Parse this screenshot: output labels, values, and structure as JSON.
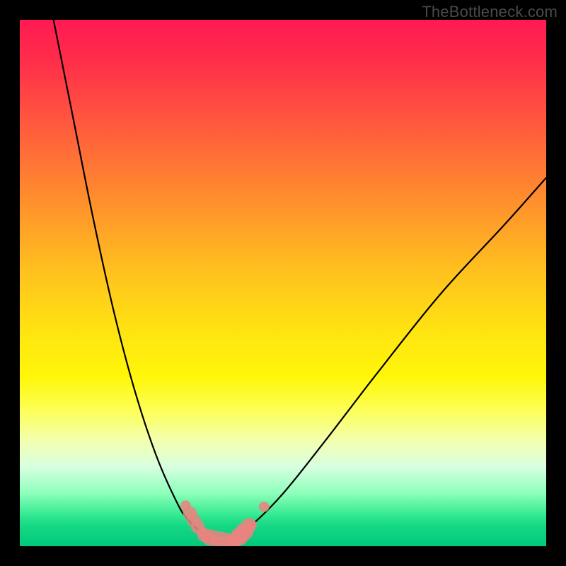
{
  "watermark": "TheBottleneck.com",
  "colors": {
    "background": "#000000",
    "curve": "#000000",
    "marker": "#e9847f",
    "gradient_top": "#ff1a52",
    "gradient_bottom": "#00c97c"
  },
  "chart_data": {
    "type": "line",
    "title": "",
    "xlabel": "",
    "ylabel": "",
    "xlim": [
      0,
      100
    ],
    "ylim": [
      0,
      100
    ],
    "grid": false,
    "series": [
      {
        "name": "left-curve",
        "x": [
          6,
          10,
          14,
          18,
          22,
          26,
          30,
          32,
          34,
          36,
          37,
          38
        ],
        "values": [
          102,
          82,
          62,
          44,
          29,
          17,
          8,
          5,
          3,
          1.5,
          1,
          0.8
        ]
      },
      {
        "name": "right-curve",
        "x": [
          38,
          40,
          44,
          50,
          58,
          68,
          80,
          92,
          100
        ],
        "values": [
          0.8,
          1.5,
          4,
          10,
          20,
          33,
          48,
          61,
          70
        ]
      }
    ],
    "markers": [
      {
        "x": 31.5,
        "y": 7.7,
        "r": 1.0
      },
      {
        "x": 32.3,
        "y": 6.3,
        "r": 1.3
      },
      {
        "x": 33.0,
        "y": 5.0,
        "r": 1.3
      },
      {
        "x": 33.8,
        "y": 3.7,
        "r": 1.3
      },
      {
        "x": 34.6,
        "y": 2.7,
        "r": 1.0
      },
      {
        "x": 36.0,
        "y": 1.4,
        "r": 1.3
      },
      {
        "x": 37.3,
        "y": 0.9,
        "r": 1.1
      },
      {
        "x": 39.0,
        "y": 0.9,
        "r": 1.1
      },
      {
        "x": 40.6,
        "y": 1.1,
        "r": 1.3
      },
      {
        "x": 41.7,
        "y": 1.8,
        "r": 1.7
      },
      {
        "x": 42.7,
        "y": 2.8,
        "r": 1.7
      },
      {
        "x": 43.5,
        "y": 4.0,
        "r": 1.3
      },
      {
        "x": 46.4,
        "y": 7.5,
        "r": 1.0
      }
    ],
    "highlight_segments": [
      {
        "x0": 35.0,
        "y0": 2.1,
        "x1": 40.7,
        "y1": 0.9,
        "w": 2.6
      },
      {
        "x0": 41.0,
        "y0": 1.2,
        "x1": 43.7,
        "y1": 4.0,
        "w": 2.6
      }
    ]
  }
}
